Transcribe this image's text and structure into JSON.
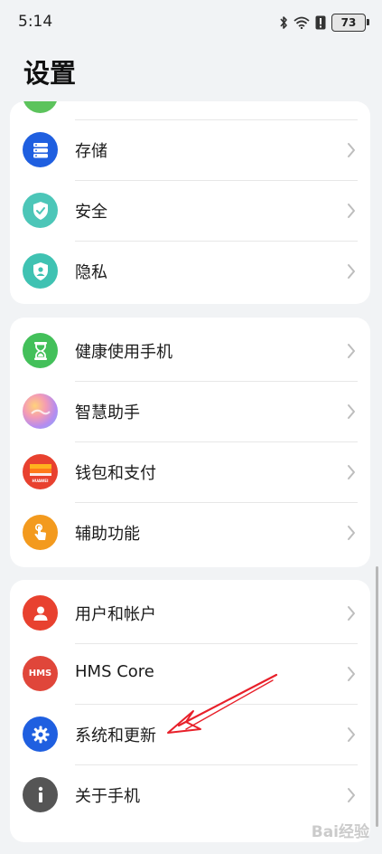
{
  "status_bar": {
    "time": "5:14",
    "battery": "73",
    "icons": [
      "bluetooth-icon",
      "wifi-icon",
      "alert-icon",
      "battery-icon"
    ]
  },
  "header": {
    "title": "设置"
  },
  "groups": [
    {
      "items": [
        {
          "label": "存储",
          "icon": "storage-icon",
          "color": "#1f5fe0"
        },
        {
          "label": "安全",
          "icon": "security-shield-icon",
          "color": "#4cc6b8"
        },
        {
          "label": "隐私",
          "icon": "privacy-shield-icon",
          "color": "#3fc2b2"
        }
      ]
    },
    {
      "items": [
        {
          "label": "健康使用手机",
          "icon": "hourglass-icon",
          "color": "#43c05a"
        },
        {
          "label": "智慧助手",
          "icon": "assistant-icon",
          "color": "#c98de8"
        },
        {
          "label": "钱包和支付",
          "icon": "wallet-icon",
          "color": "#e8412f"
        },
        {
          "label": "辅助功能",
          "icon": "accessibility-hand-icon",
          "color": "#f39a1e"
        }
      ]
    },
    {
      "items": [
        {
          "label": "用户和帐户",
          "icon": "user-icon",
          "color": "#e8412f"
        },
        {
          "label": "HMS Core",
          "icon": "hms-icon",
          "color": "#e0463a"
        },
        {
          "label": "系统和更新",
          "icon": "system-gear-icon",
          "color": "#1f5fe0"
        },
        {
          "label": "关于手机",
          "icon": "info-icon",
          "color": "#555555"
        }
      ]
    }
  ],
  "wallet_badge": "HUAWEI",
  "hms_badge": "HMS",
  "watermark": "Bai经验",
  "colors": {
    "background": "#f1f3f5",
    "annotation_arrow": "#e8202a"
  }
}
